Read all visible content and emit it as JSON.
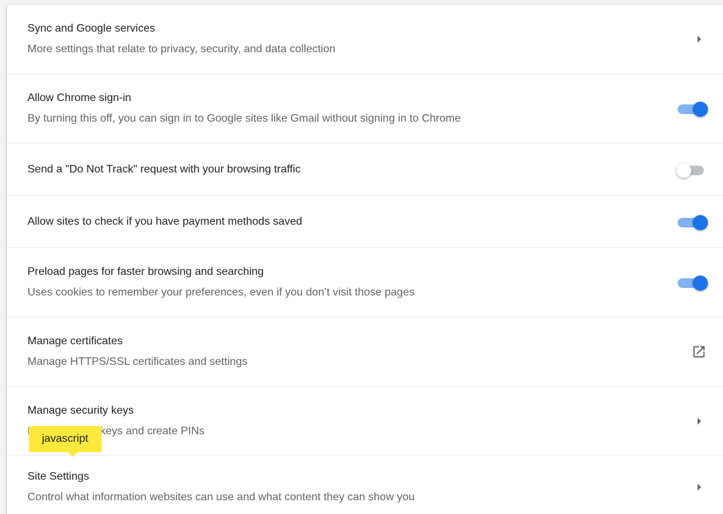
{
  "colors": {
    "accent": "#1a73e8",
    "tooltip_bg": "#fce93c"
  },
  "rows": [
    {
      "primary": "Sync and Google services",
      "secondary": "More settings that relate to privacy, security, and data collection",
      "action": "arrow-right-icon"
    },
    {
      "primary": "Allow Chrome sign-in",
      "secondary": "By turning this off, you can sign in to Google sites like Gmail without signing in to Chrome",
      "action": "toggle",
      "toggle_state": "on"
    },
    {
      "primary": "Send a \"Do Not Track\" request with your browsing traffic",
      "action": "toggle",
      "toggle_state": "off"
    },
    {
      "primary": "Allow sites to check if you have payment methods saved",
      "action": "toggle",
      "toggle_state": "on"
    },
    {
      "primary": "Preload pages for faster browsing and searching",
      "secondary": "Uses cookies to remember your preferences, even if you don’t visit those pages",
      "action": "toggle",
      "toggle_state": "on"
    },
    {
      "primary": "Manage certificates",
      "secondary": "Manage HTTPS/SSL certificates and settings",
      "action": "open-in-new-icon"
    },
    {
      "primary": "Manage security keys",
      "secondary": "Reset security keys and create PINs",
      "action": "arrow-right-icon"
    },
    {
      "primary": "Site Settings",
      "secondary": "Control what information websites can use and what content they can show you",
      "action": "arrow-right-icon"
    }
  ],
  "tooltip": {
    "text": "javascript"
  }
}
